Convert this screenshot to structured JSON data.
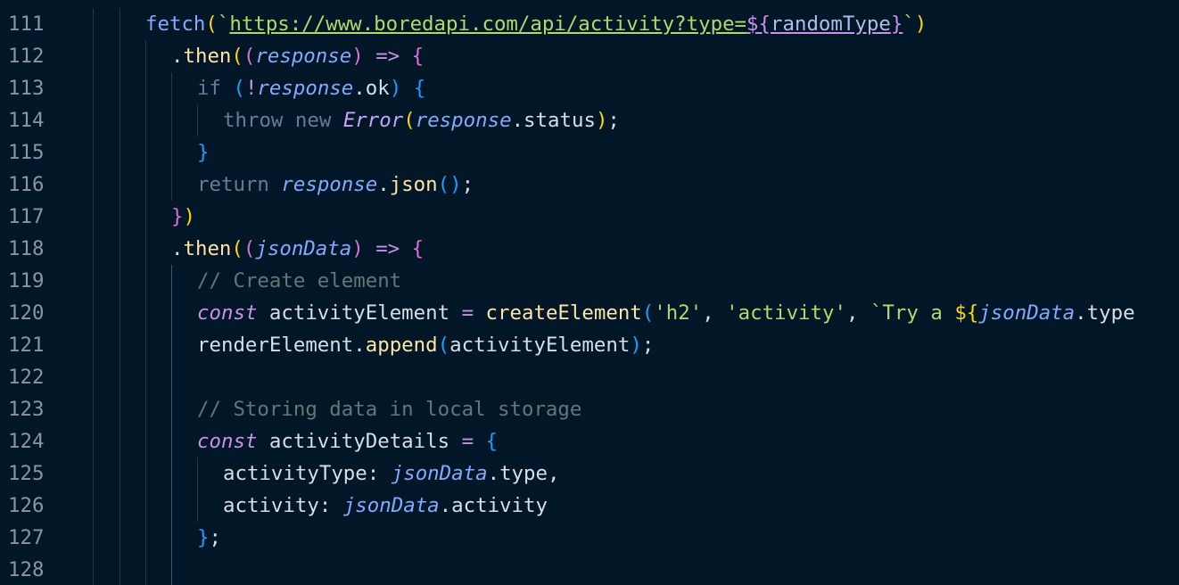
{
  "editor": {
    "language": "javascript",
    "theme_background": "#011627",
    "line_numbers": [
      "111",
      "112",
      "113",
      "114",
      "115",
      "116",
      "117",
      "118",
      "119",
      "120",
      "121",
      "122",
      "123",
      "124",
      "125",
      "126",
      "127",
      "128"
    ],
    "lines": [
      {
        "tokens": [
          {
            "t": "fetch",
            "c": "t-fn"
          },
          {
            "t": "(",
            "c": "t-br1"
          },
          {
            "t": "`",
            "c": "t-str"
          },
          {
            "t": "https://www.boredapi.com/api/activity?type=",
            "c": "t-url"
          },
          {
            "t": "${",
            "c": "t-tpl t-tplbox"
          },
          {
            "t": "randomType",
            "c": "t-var t-tplbox"
          },
          {
            "t": "}",
            "c": "t-tpl t-tplbox"
          },
          {
            "t": "`",
            "c": "t-str"
          },
          {
            "t": ")",
            "c": "t-br1"
          }
        ]
      },
      {
        "tokens": [
          {
            "t": ".",
            "c": "t-pl"
          },
          {
            "t": "then",
            "c": "t-met"
          },
          {
            "t": "(",
            "c": "t-br1"
          },
          {
            "t": "(",
            "c": "t-br2"
          },
          {
            "t": "response",
            "c": "t-ital"
          },
          {
            "t": ")",
            "c": "t-br2"
          },
          {
            "t": " ",
            "c": "t-pl"
          },
          {
            "t": "=>",
            "c": "t-op"
          },
          {
            "t": " ",
            "c": "t-pl"
          },
          {
            "t": "{",
            "c": "t-br2"
          }
        ]
      },
      {
        "tokens": [
          {
            "t": "if",
            "c": "t-ctl"
          },
          {
            "t": " ",
            "c": "t-pl"
          },
          {
            "t": "(",
            "c": "t-br3"
          },
          {
            "t": "!",
            "c": "t-op"
          },
          {
            "t": "response",
            "c": "t-ital"
          },
          {
            "t": ".",
            "c": "t-pl"
          },
          {
            "t": "ok",
            "c": "t-prop"
          },
          {
            "t": ")",
            "c": "t-br3"
          },
          {
            "t": " ",
            "c": "t-pl"
          },
          {
            "t": "{",
            "c": "t-br3"
          }
        ]
      },
      {
        "tokens": [
          {
            "t": "throw",
            "c": "t-ctl"
          },
          {
            "t": " ",
            "c": "t-pl"
          },
          {
            "t": "new",
            "c": "t-ctl"
          },
          {
            "t": " ",
            "c": "t-pl"
          },
          {
            "t": "Error",
            "c": "t-cls"
          },
          {
            "t": "(",
            "c": "t-br1"
          },
          {
            "t": "response",
            "c": "t-ital"
          },
          {
            "t": ".",
            "c": "t-pl"
          },
          {
            "t": "status",
            "c": "t-prop"
          },
          {
            "t": ")",
            "c": "t-br1"
          },
          {
            "t": ";",
            "c": "t-pl"
          }
        ]
      },
      {
        "tokens": [
          {
            "t": "}",
            "c": "t-br3"
          }
        ]
      },
      {
        "tokens": [
          {
            "t": "return",
            "c": "t-ctl"
          },
          {
            "t": " ",
            "c": "t-pl"
          },
          {
            "t": "response",
            "c": "t-ital"
          },
          {
            "t": ".",
            "c": "t-pl"
          },
          {
            "t": "json",
            "c": "t-met"
          },
          {
            "t": "(",
            "c": "t-br3"
          },
          {
            "t": ")",
            "c": "t-br3"
          },
          {
            "t": ";",
            "c": "t-pl"
          }
        ]
      },
      {
        "tokens": [
          {
            "t": "}",
            "c": "t-br2"
          },
          {
            "t": ")",
            "c": "t-br1"
          }
        ]
      },
      {
        "tokens": [
          {
            "t": ".",
            "c": "t-pl"
          },
          {
            "t": "then",
            "c": "t-met"
          },
          {
            "t": "(",
            "c": "t-br1"
          },
          {
            "t": "(",
            "c": "t-br2"
          },
          {
            "t": "jsonData",
            "c": "t-ital"
          },
          {
            "t": ")",
            "c": "t-br2"
          },
          {
            "t": " ",
            "c": "t-pl"
          },
          {
            "t": "=>",
            "c": "t-op"
          },
          {
            "t": " ",
            "c": "t-pl"
          },
          {
            "t": "{",
            "c": "t-br2"
          }
        ]
      },
      {
        "tokens": [
          {
            "t": "// Create element",
            "c": "t-com"
          }
        ]
      },
      {
        "tokens": [
          {
            "t": "const",
            "c": "t-kw"
          },
          {
            "t": " activityElement ",
            "c": "t-pl"
          },
          {
            "t": "=",
            "c": "t-op"
          },
          {
            "t": " ",
            "c": "t-pl"
          },
          {
            "t": "createElement",
            "c": "t-met"
          },
          {
            "t": "(",
            "c": "t-br3"
          },
          {
            "t": "'h2'",
            "c": "t-str"
          },
          {
            "t": ", ",
            "c": "t-pl"
          },
          {
            "t": "'activity'",
            "c": "t-str"
          },
          {
            "t": ", ",
            "c": "t-pl"
          },
          {
            "t": "`Try a ",
            "c": "t-str"
          },
          {
            "t": "${",
            "c": "t-br1"
          },
          {
            "t": "jsonData",
            "c": "t-ital"
          },
          {
            "t": ".",
            "c": "t-pl"
          },
          {
            "t": "type",
            "c": "t-prop"
          }
        ]
      },
      {
        "tokens": [
          {
            "t": "renderElement",
            "c": "t-pl"
          },
          {
            "t": ".",
            "c": "t-pl"
          },
          {
            "t": "append",
            "c": "t-met"
          },
          {
            "t": "(",
            "c": "t-br3"
          },
          {
            "t": "activityElement",
            "c": "t-pl"
          },
          {
            "t": ")",
            "c": "t-br3"
          },
          {
            "t": ";",
            "c": "t-pl"
          }
        ]
      },
      {
        "tokens": []
      },
      {
        "tokens": [
          {
            "t": "// Storing data in local storage",
            "c": "t-com"
          }
        ]
      },
      {
        "tokens": [
          {
            "t": "const",
            "c": "t-kw"
          },
          {
            "t": " activityDetails ",
            "c": "t-pl"
          },
          {
            "t": "=",
            "c": "t-op"
          },
          {
            "t": " ",
            "c": "t-pl"
          },
          {
            "t": "{",
            "c": "t-br3"
          }
        ]
      },
      {
        "tokens": [
          {
            "t": "activityType",
            "c": "t-prop"
          },
          {
            "t": ": ",
            "c": "t-pl"
          },
          {
            "t": "jsonData",
            "c": "t-ital"
          },
          {
            "t": ".",
            "c": "t-pl"
          },
          {
            "t": "type",
            "c": "t-prop"
          },
          {
            "t": ",",
            "c": "t-pl"
          }
        ]
      },
      {
        "tokens": [
          {
            "t": "activity",
            "c": "t-prop"
          },
          {
            "t": ": ",
            "c": "t-pl"
          },
          {
            "t": "jsonData",
            "c": "t-ital"
          },
          {
            "t": ".",
            "c": "t-pl"
          },
          {
            "t": "activity",
            "c": "t-prop"
          }
        ]
      },
      {
        "tokens": [
          {
            "t": "}",
            "c": "t-br3"
          },
          {
            "t": ";",
            "c": "t-pl"
          }
        ]
      },
      {
        "tokens": []
      }
    ]
  }
}
